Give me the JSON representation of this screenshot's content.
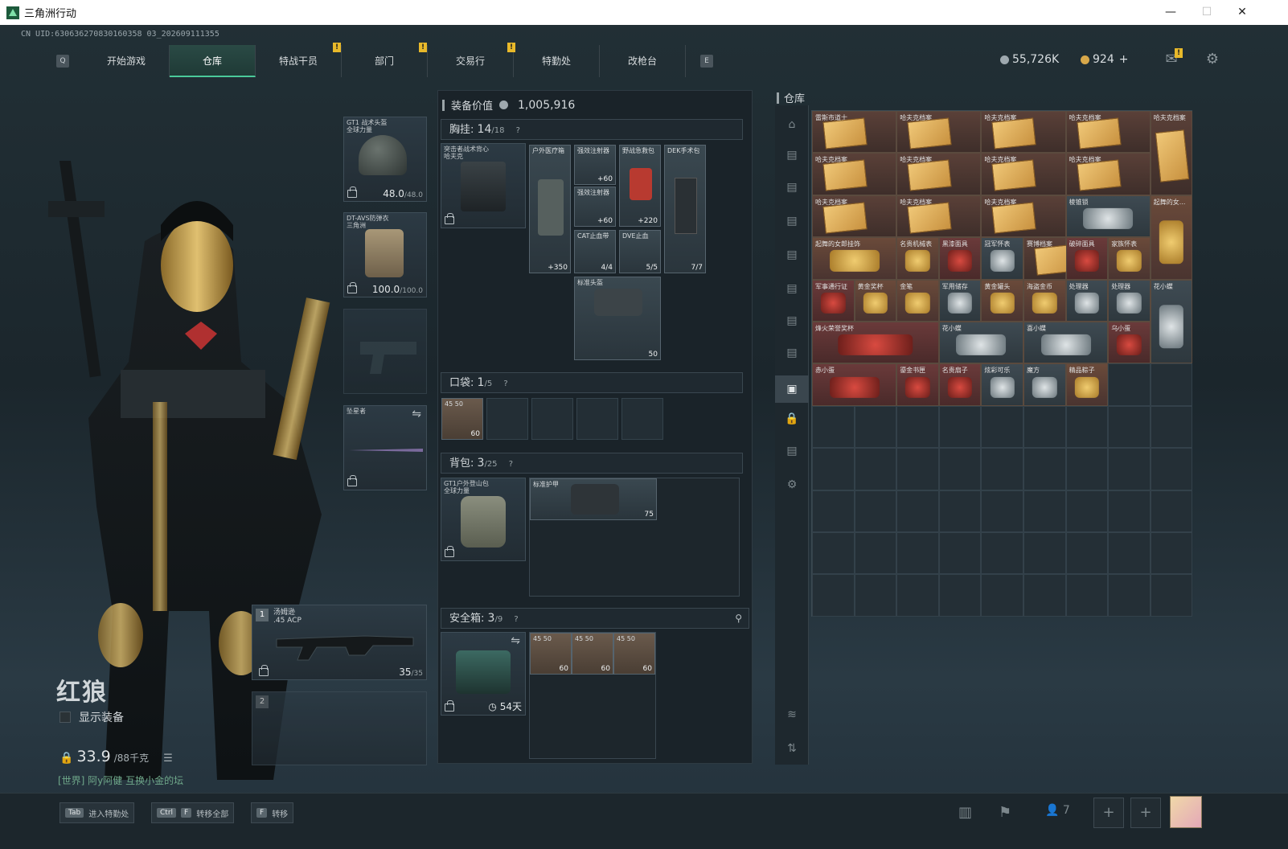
{
  "window": {
    "title": "三角洲行动",
    "min": "—",
    "max": "☐",
    "close": "✕"
  },
  "uid": "CN UID:630636270830160358 03_202609111355",
  "tabs": {
    "left_key": "Q",
    "right_key": "E",
    "items": [
      {
        "label": "开始游戏",
        "badge": ""
      },
      {
        "label": "仓库",
        "badge": "",
        "active": true
      },
      {
        "label": "特战干员",
        "badge": "!"
      },
      {
        "label": "部门",
        "badge": "!"
      },
      {
        "label": "交易行",
        "badge": ""
      },
      {
        "label": "特勤处",
        "badge": "!"
      },
      {
        "label": "改枪台",
        "badge": ""
      }
    ]
  },
  "currency": {
    "silver": "55,726K",
    "gold": "924",
    "add": "+",
    "mail_badge": "!"
  },
  "operator": {
    "name": "红狼",
    "show_gear": "显示装备",
    "weight": "33.9",
    "weight_max": "/88千克",
    "chat": "[世界] 阿y阿健  互换小金的坛"
  },
  "gear": {
    "helmet": {
      "name": "GT1 战术头盔",
      "sub": "全球力量",
      "durability": "48.0",
      "max": "/48.0"
    },
    "armor": {
      "name": "DT-AVS防弹衣",
      "sub": "三角洲",
      "durability": "100.0",
      "max": "/100.0"
    },
    "melee": {
      "name": "坠星者"
    },
    "primary": {
      "slot": "1",
      "name": "汤姆逊",
      "ammo_type": ".45 ACP",
      "ammo": "35",
      "ammo_max": "/35"
    },
    "secondary": {
      "slot": "2"
    }
  },
  "equip_value": {
    "label": "装备价值",
    "value": "1,005,916"
  },
  "chest": {
    "label": "胸挂:",
    "count": "14",
    "cap": "/18",
    "help": "?",
    "rig": {
      "name": "突击者战术背心",
      "sub": "哈夫克"
    },
    "items": [
      {
        "name": "户外医疗箱",
        "val": "+350"
      },
      {
        "name": "强效注射器",
        "val": "+60"
      },
      {
        "name": "强效注射器",
        "val": "+60"
      },
      {
        "name": "野战急救包",
        "val": "+220"
      },
      {
        "name": "DEK手术包",
        "val": "7/7"
      },
      {
        "name": "CAT止血带",
        "val": "4/4"
      },
      {
        "name": "DVE止血",
        "val": "5/5"
      },
      {
        "name": "标准头盔",
        "val": "50"
      }
    ]
  },
  "pocket": {
    "label": "口袋:",
    "count": "1",
    "cap": "/5",
    "help": "?",
    "item": {
      "name": "45 50",
      "val": "60"
    }
  },
  "backpack": {
    "label": "背包:",
    "count": "3",
    "cap": "/25",
    "help": "?",
    "bag": {
      "name": "GT1户外登山包",
      "sub": "全球力量"
    },
    "item": {
      "name": "标准护甲",
      "val": "75"
    }
  },
  "safebox": {
    "label": "安全箱:",
    "count": "3",
    "cap": "/9",
    "help": "?",
    "days": "54天",
    "items": [
      {
        "name": "45 50",
        "val": "60"
      },
      {
        "name": "45 50",
        "val": "60"
      },
      {
        "name": "45 50",
        "val": "60"
      }
    ]
  },
  "stash": {
    "label": "仓库",
    "items": [
      {
        "name": "雷斯市道士"
      },
      {
        "name": "哈夫克档案"
      },
      {
        "name": "哈夫克档案"
      },
      {
        "name": "哈夫克档案"
      },
      {
        "name": "哈夫克档案"
      },
      {
        "name": "哈夫克档案"
      },
      {
        "name": "哈夫克档案"
      },
      {
        "name": "哈夫克档案"
      },
      {
        "name": "哈夫克档案"
      },
      {
        "name": "哈夫克档案"
      },
      {
        "name": "哈夫克档案"
      },
      {
        "name": "哈夫克档案"
      },
      {
        "name": "棱锥锁"
      },
      {
        "name": "起舞的女..."
      },
      {
        "name": "起舞的女郎挂饰"
      },
      {
        "name": "名贵机械表"
      },
      {
        "name": "黑漆面具"
      },
      {
        "name": "冠军怀表"
      },
      {
        "name": "赛博档案"
      },
      {
        "name": "破碎面具"
      },
      {
        "name": "家族怀表"
      },
      {
        "name": "军事通行证"
      },
      {
        "name": "黄金奖杯"
      },
      {
        "name": "金笔"
      },
      {
        "name": "军用储存"
      },
      {
        "name": "黄金罐头"
      },
      {
        "name": "海盗金币"
      },
      {
        "name": "处理器"
      },
      {
        "name": "处理器"
      },
      {
        "name": "花小蝶"
      },
      {
        "name": "烽火荣誉奖杯"
      },
      {
        "name": "花小蝶"
      },
      {
        "name": "喜小蝶"
      },
      {
        "name": "乌小蛋"
      },
      {
        "name": "赤小蛋"
      },
      {
        "name": "鎏金书匣"
      },
      {
        "name": "名贵扇子"
      },
      {
        "name": "炫彩可乐"
      },
      {
        "name": "魔方"
      },
      {
        "name": "精品粽子"
      }
    ]
  },
  "bottom": {
    "tab_key": "Tab",
    "tab_label": "进入特勤处",
    "ctrl_key": "Ctrl",
    "f_key": "F",
    "transfer_all": "转移全部",
    "f2_key": "F",
    "transfer": "转移",
    "friends": "7",
    "add": "+"
  },
  "colors": {
    "accent": "#4ac99a",
    "badge": "#e8b92a",
    "gold": "#d8a84a"
  }
}
